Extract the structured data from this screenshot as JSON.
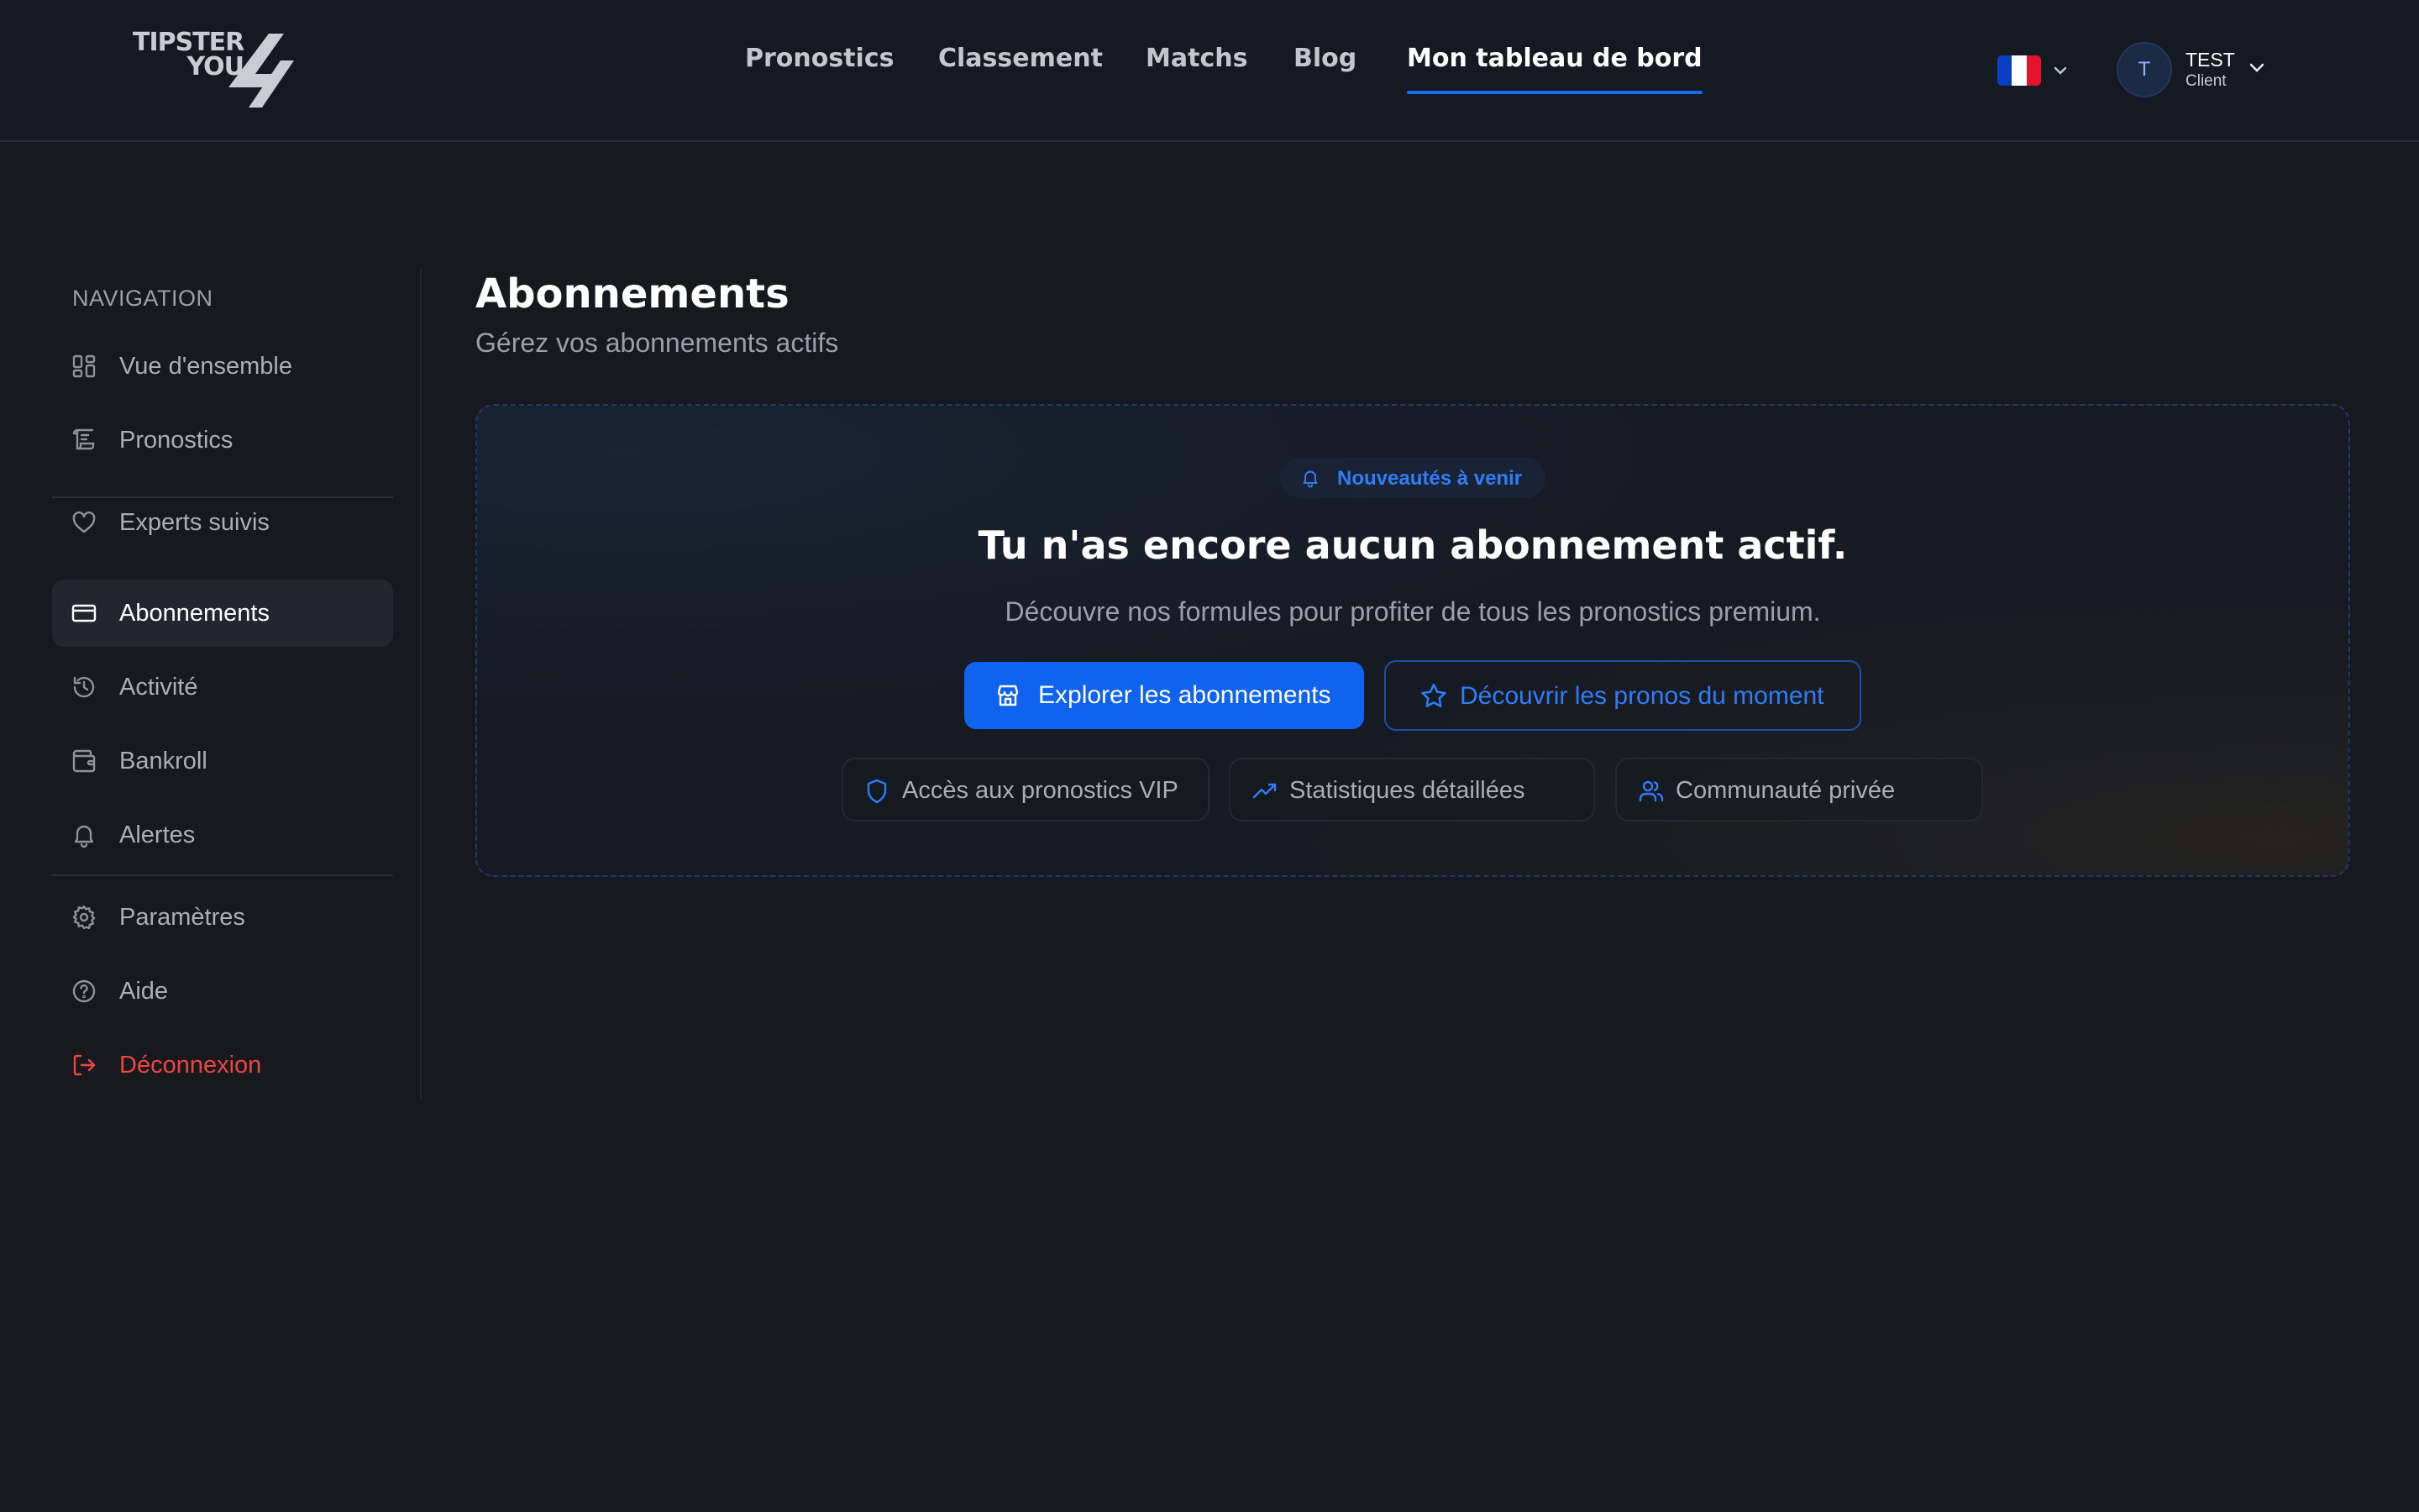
{
  "header": {
    "logo": {
      "line1": "TIPSTER",
      "line2": "YOU"
    },
    "nav": [
      {
        "label": "Pronostics"
      },
      {
        "label": "Classement"
      },
      {
        "label": "Matchs"
      },
      {
        "label": "Blog"
      },
      {
        "label": "Mon tableau de bord",
        "active": true
      }
    ],
    "language": {
      "flag": "fr-flag",
      "colors": [
        "#0a3fc4",
        "#ffffff",
        "#e3142a"
      ]
    },
    "user": {
      "initial": "T",
      "name": "TEST",
      "role": "Client"
    }
  },
  "sidebar": {
    "heading": "NAVIGATION",
    "items": [
      {
        "label": "Vue d'ensemble",
        "icon": "dashboard-icon"
      },
      {
        "label": "Pronostics",
        "icon": "scroll-icon"
      },
      {
        "label": "Experts suivis",
        "icon": "heart-icon"
      },
      {
        "label": "Abonnements",
        "icon": "credit-card-icon",
        "active": true
      },
      {
        "label": "Activité",
        "icon": "history-icon"
      },
      {
        "label": "Bankroll",
        "icon": "wallet-icon"
      },
      {
        "label": "Alertes",
        "icon": "bell-icon"
      },
      {
        "label": "Paramètres",
        "icon": "gear-icon"
      },
      {
        "label": "Aide",
        "icon": "help-circle-icon"
      },
      {
        "label": "Déconnexion",
        "icon": "logout-icon",
        "danger": true
      }
    ]
  },
  "main": {
    "title": "Abonnements",
    "subtitle": "Gérez vos abonnements actifs",
    "empty_state": {
      "badge": "Nouveautés à venir",
      "title": "Tu n'as encore aucun abonnement actif.",
      "subtitle": "Découvre nos formules pour profiter de tous les pronostics premium.",
      "primary_button": "Explorer les abonnements",
      "secondary_button": "Découvrir les pronos du moment",
      "features": [
        {
          "label": "Accès aux pronostics VIP",
          "icon": "shield-icon"
        },
        {
          "label": "Statistiques détaillées",
          "icon": "trending-up-icon"
        },
        {
          "label": "Communauté privée",
          "icon": "users-icon"
        }
      ]
    }
  },
  "colors": {
    "accent": "#0f63ee",
    "accent_text": "#2f7df6",
    "danger": "#ef4444",
    "background": "#17191e",
    "header_bg": "#141922"
  }
}
